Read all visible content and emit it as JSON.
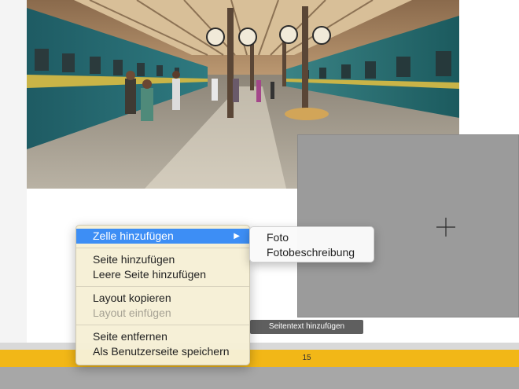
{
  "context_menu": {
    "add_cell": "Zelle hinzufügen",
    "add_page": "Seite hinzufügen",
    "add_blank_page": "Leere Seite hinzufügen",
    "copy_layout": "Layout kopieren",
    "paste_layout": "Layout einfügen",
    "remove_page": "Seite entfernen",
    "save_as_user_page": "Als Benutzerseite speichern"
  },
  "submenu": {
    "photo": "Foto",
    "photo_caption": "Fotobeschreibung"
  },
  "page_text_button": "Seitentext hinzufügen",
  "page_number": "15",
  "colors": {
    "highlight": "#3d8ef5",
    "page_strip": "#f2b717",
    "empty_cell": "#9b9b9b"
  },
  "icons": {
    "submenu_arrow": "triangle-right",
    "crosshair": "plus"
  }
}
